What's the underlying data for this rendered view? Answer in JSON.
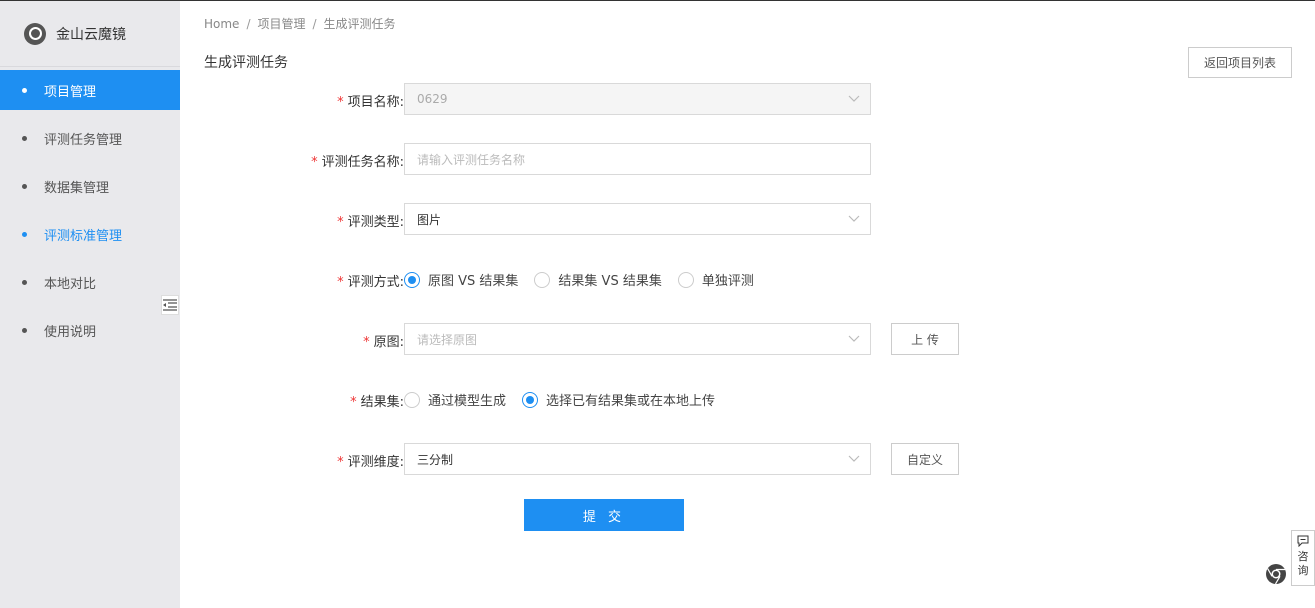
{
  "app": {
    "name": "金山云魔镜"
  },
  "sidebar": {
    "items": [
      {
        "label": "项目管理"
      },
      {
        "label": "评测任务管理"
      },
      {
        "label": "数据集管理"
      },
      {
        "label": "评测标准管理"
      },
      {
        "label": "本地对比"
      },
      {
        "label": "使用说明"
      }
    ]
  },
  "breadcrumb": {
    "home": "Home",
    "level1": "项目管理",
    "level2": "生成评测任务",
    "sep": "/"
  },
  "page": {
    "title": "生成评测任务",
    "back_label": "返回项目列表"
  },
  "form": {
    "required_mark": "*",
    "project_name": {
      "label": "项目名称:",
      "value": "0629"
    },
    "task_name": {
      "label": "评测任务名称:",
      "placeholder": "请输入评测任务名称"
    },
    "eval_type": {
      "label": "评测类型:",
      "value": "图片"
    },
    "eval_method": {
      "label": "评测方式:",
      "options": [
        "原图 VS 结果集",
        "结果集 VS 结果集",
        "单独评测"
      ]
    },
    "original": {
      "label": "原图:",
      "placeholder": "请选择原图",
      "upload_label": "上 传"
    },
    "result_set": {
      "label": "结果集:",
      "options": [
        "通过模型生成",
        "选择已有结果集或在本地上传"
      ]
    },
    "dimension": {
      "label": "评测维度:",
      "value": "三分制",
      "custom_label": "自定义"
    },
    "submit_label": "提 交"
  },
  "consult": {
    "label_1": "咨",
    "label_2": "询"
  },
  "colors": {
    "accent": "#1e8ff2",
    "required": "#e33333",
    "sidebar_bg": "#e9e9ec"
  }
}
